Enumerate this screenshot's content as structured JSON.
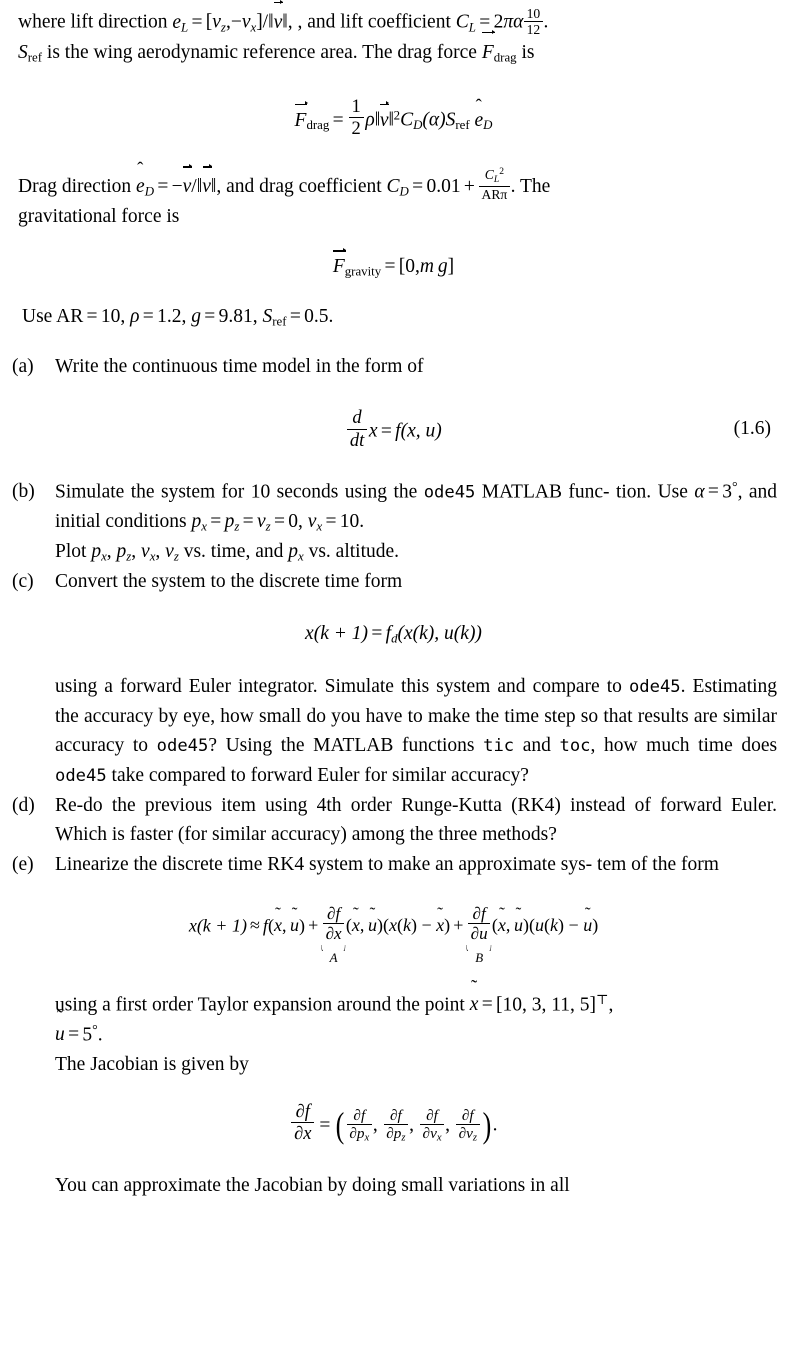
{
  "document": {
    "intro": {
      "line1_prefix": "where lift direction",
      "line1_mid": ", and lift coefficient",
      "lift_dir_lhs": "e",
      "lift_dir_sub": "L",
      "lift_dir_rhs_open": "[",
      "lift_dir_v1": "v",
      "lift_dir_v1_sub": "z",
      "lift_dir_comma": ",",
      "lift_dir_minus": "−",
      "lift_dir_v2": "v",
      "lift_dir_v2_sub": "x",
      "lift_dir_close": "]/‖",
      "lift_dir_norm_close": "‖,",
      "cl_symbol": "C",
      "cl_sub": "L",
      "cl_value_lead": "2",
      "cl_pi": "π",
      "cl_alpha": "α",
      "cl_frac_num": "10",
      "cl_frac_den": "12",
      "cl_period": ".",
      "line2_sref": "S",
      "line2_sref_sub": "ref",
      "line2_text": "is the wing aerodynamic reference area. The drag force",
      "line2_fdrag": "F",
      "line2_fdrag_sub": "drag",
      "line2_end": "is"
    },
    "eq_drag": {
      "lhs_F": "F",
      "lhs_sub": "drag",
      "equals": "=",
      "frac_num": "1",
      "frac_den": "2",
      "rho": "ρ",
      "norm_open": "‖",
      "v": "v",
      "norm_close": "‖",
      "power": "2",
      "cd": "C",
      "cd_sub": "D",
      "alpha_paren": "(α)",
      "sref": "S",
      "sref_sub": "ref",
      "ehat": "e",
      "ehat_sub": "D"
    },
    "drag_dir": {
      "prefix": "Drag direction",
      "ehat": "e",
      "ehat_sub": "D",
      "equals": "=",
      "minus": "−",
      "v": "v",
      "slash_norm": "/‖",
      "norm_close": "‖,",
      "mid": "and drag coefficient",
      "cd": "C",
      "cd_sub": "D",
      "cd_equals": "=",
      "cd_const": "0.01",
      "plus": "+",
      "cd_frac_num_base": "C",
      "cd_frac_num_sub": "L",
      "cd_frac_num_sup": "2",
      "cd_frac_den": "ARπ",
      "suffix": ". The",
      "line2": "gravitational force is"
    },
    "eq_gravity": {
      "lhs_F": "F",
      "lhs_sub": "gravity",
      "equals": "=",
      "rhs_open": "[0,",
      "m": "m",
      "g": "g",
      "rhs_close": "]"
    },
    "constants_line": {
      "prefix": "Use AR",
      "eq1": "=",
      "ar": "10,",
      "rho": "ρ",
      "eq2": "=",
      "rho_val": "1.2,",
      "g": "g",
      "eq3": "=",
      "g_val": "9.81,",
      "sref": "S",
      "sref_sub": "ref",
      "eq4": "=",
      "sref_val": "0.5."
    },
    "items": [
      {
        "label": "(a)",
        "text": "Write the continuous time model in the form of"
      },
      {
        "label": "(b)",
        "line1": "Simulate the system for 10 seconds using the",
        "code1": "ode45",
        "line1b": "MATLAB func-",
        "line2_pre": "tion. Use",
        "alpha": "α",
        "eq": "=",
        "alpha_val": "3",
        "deg": "°",
        "line2_mid": ", and initial conditions",
        "px": "p",
        "px_sub": "x",
        "pz": "p",
        "pz_sub": "z",
        "vz": "v",
        "vz_sub": "z",
        "zero": "0,",
        "vx": "v",
        "vx_sub": "x",
        "vx_val": "10.",
        "line3_pre": "Plot",
        "line3_post": "vs. time, and",
        "line3_end": "vs. altitude."
      },
      {
        "label": "(c)",
        "line1": "Convert the system to the discrete time form",
        "body_l1": "using a forward Euler integrator. Simulate this system and compare",
        "body_l2_pre": "to",
        "body_code1": "ode45",
        "body_l2_post": ". Estimating the accuracy by eye, how small do you have",
        "body_l3_pre": "to make the time step so that results are similar accuracy to",
        "body_code2": "ode45",
        "body_l3_post": "?",
        "body_l4_pre": "Using the MATLAB functions",
        "body_code3": "tic",
        "body_l4_mid": "and",
        "body_code4": "toc",
        "body_l4_post": ", how much time does",
        "body_l5_code": "ode45",
        "body_l5_post": "take compared to forward Euler for similar accuracy?"
      },
      {
        "label": "(d)",
        "line1": "Re-do the previous item using 4th order Runge-Kutta (RK4) instead",
        "line2": "of forward Euler. Which is faster (for similar accuracy) among the",
        "line3": "three methods?"
      },
      {
        "label": "(e)",
        "line1": "Linearize the discrete time RK4 system to make an approximate sys-",
        "line2": "tem of the form"
      }
    ],
    "eq_16": {
      "dfrac_num": "d",
      "dfrac_den": "dt",
      "x": "x",
      "equals": "=",
      "f": "f",
      "args": "(x, u)",
      "number": "(1.6)"
    },
    "eq_discrete": {
      "lhs_x": "x",
      "lhs_arg": "(k + 1)",
      "equals": "=",
      "fd": "f",
      "fd_sub": "d",
      "rhs": "(x(k), u(k))"
    },
    "eq_taylor": {
      "lhs_x": "x",
      "lhs_arg": "(k + 1)",
      "approx": "≈",
      "f": "f",
      "f_args_open": "(",
      "xt": "x",
      "comma": ",",
      "ut": "u",
      "f_args_close": ")",
      "plus1": "+",
      "df_num_d": "∂",
      "df_num_f": "f",
      "df_den_d": "∂",
      "df_den_x": "x",
      "term_a_args": "(x(k) − x)",
      "label_a": "A",
      "plus2": "+",
      "df2_den_u": "u",
      "term_b_args": "(u(k) − u)",
      "label_b": "B"
    },
    "taylor_point": {
      "line_pre": "using a first order Taylor expansion around the point",
      "xt": "x",
      "equals": "=",
      "vector": "[10, 3, 11, 5]",
      "transpose": "⊤",
      "comma": ",",
      "ut": "u",
      "u_equals": "=",
      "u_val": "5",
      "u_deg": "°",
      "u_period": ".",
      "jacobian_intro": "The Jacobian is given by"
    },
    "eq_jacobian": {
      "lhs_num_d": "∂",
      "lhs_num_f": "f",
      "lhs_den_d": "∂",
      "lhs_den_x": "x",
      "equals": "=",
      "paren_open": "(",
      "t1_den": "p",
      "t1_den_sub": "x",
      "t2_den": "p",
      "t2_den_sub": "z",
      "t3_den": "v",
      "t3_den_sub": "x",
      "t4_den": "v",
      "t4_den_sub": "z",
      "partial": "∂",
      "f": "f",
      "comma": ",",
      "paren_close": ")",
      "period": "."
    },
    "closing_line": "You can approximate the Jacobian by doing small variations in all"
  }
}
